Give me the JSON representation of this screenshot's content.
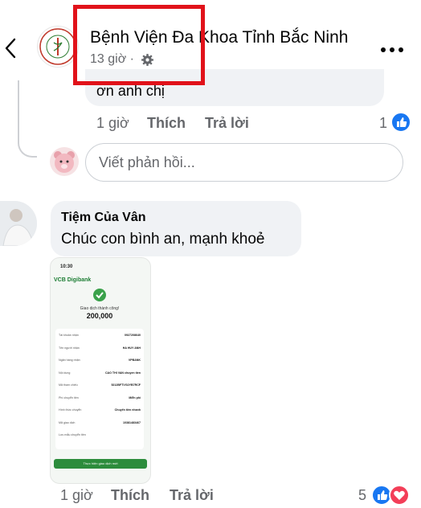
{
  "header": {
    "page_name": "Bệnh Viện Đa Khoa Tỉnh Bắc Ninh",
    "post_time": "13 giờ ·"
  },
  "previous_reply": {
    "text": "ơn anh chị",
    "time": "1 giờ",
    "like_label": "Thích",
    "reply_label": "Trả lời",
    "reaction_count": "1"
  },
  "reply_box": {
    "placeholder": "Viết phản hồi..."
  },
  "comment": {
    "author": "Tiệm Của Vân",
    "text": "Chúc con bình an, mạnh khoẻ",
    "time": "1 giờ",
    "like_label": "Thích",
    "reply_label": "Trả lời",
    "reaction_count": "5"
  },
  "transfer_screenshot": {
    "status_time": "10:30",
    "bank_name": "VCB Digibank",
    "success_text": "Giao dịch thành công!",
    "amount": "200,000",
    "button": "Thực hiện giao dịch mới",
    "rows": [
      {
        "label": "Tài khoản nhận",
        "value": "0927208640"
      },
      {
        "label": "Tên người nhận",
        "value": "HA HUY ANH"
      },
      {
        "label": "Ngân hàng nhận",
        "value": "VPBANK"
      },
      {
        "label": "Nội dung",
        "value": "CAO THI VAN chuyen tien"
      },
      {
        "label": "Mã tham chiếu",
        "value": "5212BFTVG2YB7RCF"
      },
      {
        "label": "Phí chuyển tiền",
        "value": "Miễn phí"
      },
      {
        "label": "Hình thức chuyển",
        "value": "Chuyển tiền nhanh"
      },
      {
        "label": "Mã giao dịch",
        "value": "10381483467"
      },
      {
        "label": "Lưu mẫu chuyển tiền",
        "value": ""
      }
    ]
  },
  "colors": {
    "annotation_box": "#e1121a",
    "like_blue": "#1877f2",
    "love_red": "#f33e58",
    "bank_green": "#2c8c3c"
  }
}
